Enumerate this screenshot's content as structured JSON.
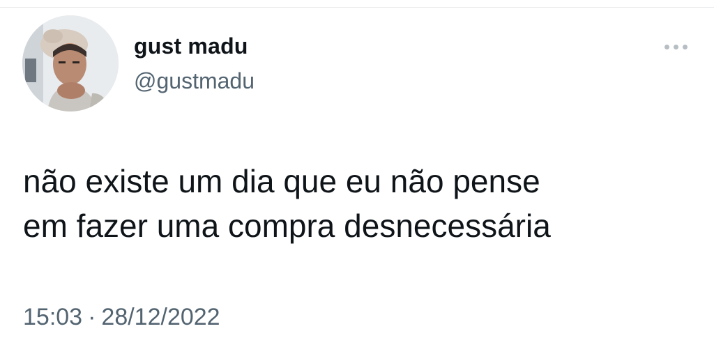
{
  "tweet": {
    "author": {
      "display_name": "gust madu",
      "handle": "@gustmadu",
      "avatar_icon": "user-photo-avatar"
    },
    "more_icon": "ellipsis-horizontal-icon",
    "text_lines": [
      "não existe um dia que eu não pense",
      "em fazer uma compra desnecessária"
    ],
    "time": "15:03",
    "separator": "·",
    "date": "28/12/2022"
  },
  "colors": {
    "text": "#0f1419",
    "secondary": "#536471",
    "dots": "#b6bec4",
    "background": "#ffffff"
  }
}
